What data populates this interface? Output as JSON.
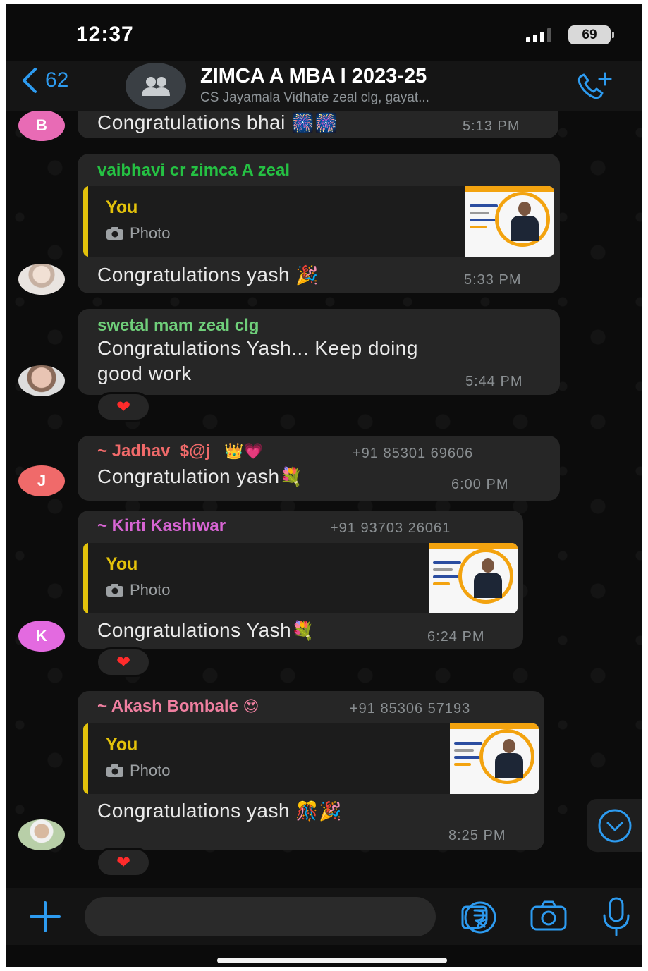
{
  "status_bar": {
    "time": "12:37",
    "battery": "69"
  },
  "header": {
    "back_count": "62",
    "title": "ZIMCA A MBA I 2023-25",
    "subtitle": "CS Jayamala Vidhate zeal clg, gayat..."
  },
  "messages": [
    {
      "avatar_letter": "B",
      "avatar_color": "#e86bb5",
      "text": "Congratulations bhai",
      "emoji": "🎆🎆",
      "time": "5:13 PM"
    },
    {
      "sender": "vaibhavi cr zimca A zeal",
      "sender_color": "#25c143",
      "quote_author": "You",
      "quote_label": "Photo",
      "text": "Congratulations yash",
      "emoji": "🎉",
      "time": "5:33 PM"
    },
    {
      "sender": "swetal mam zeal clg",
      "sender_color": "#6fcf7a",
      "text_line1": "Congratulations Yash... Keep doing",
      "text_line2": "good work",
      "time": "5:44 PM",
      "reaction": "❤"
    },
    {
      "avatar_letter": "J",
      "avatar_color": "#f06a6a",
      "sender": "~ Jadhav_$@j_",
      "sender_emoji": "👑💗",
      "sender_color": "#f06a6a",
      "phone": "+91 85301 69606",
      "text": "Congratulation yash",
      "emoji": "💐",
      "time": "6:00 PM"
    },
    {
      "avatar_letter": "K",
      "avatar_color": "#e36ae0",
      "sender": "~ Kirti Kashiwar",
      "sender_color": "#d865d4",
      "phone": "+91 93703 26061",
      "quote_author": "You",
      "quote_label": "Photo",
      "text": "Congratulations Yash",
      "emoji": "💐",
      "time": "6:24 PM",
      "reaction": "❤"
    },
    {
      "sender": "~ Akash Bombale",
      "sender_emoji": "😍",
      "sender_color": "#ef7fa0",
      "phone": "+91 85306 57193",
      "quote_author": "You",
      "quote_label": "Photo",
      "text": "Congratulations yash",
      "emoji": "🎊🎉",
      "time": "8:25 PM",
      "reaction": "❤"
    }
  ],
  "icons": {
    "back": "chevron-left-icon",
    "group": "group-avatar-icon",
    "call": "call-add-icon",
    "composer": [
      "plus-icon",
      "sticker-icon",
      "rupee-icon",
      "camera-icon",
      "mic-icon"
    ],
    "scroll": "chevron-down-icon"
  },
  "colors": {
    "accent": "#2d9bf0",
    "quote_yellow": "#e3c20b",
    "bubble": "#262626"
  }
}
